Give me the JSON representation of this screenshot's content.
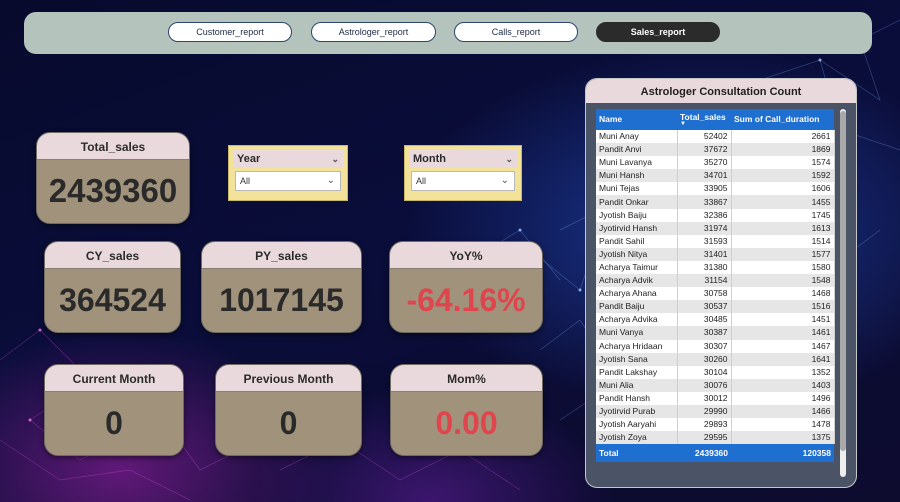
{
  "nav": {
    "tabs": [
      {
        "label": "Customer_report",
        "active": false
      },
      {
        "label": "Astrologer_report",
        "active": false
      },
      {
        "label": "Calls_report",
        "active": false
      },
      {
        "label": "Sales_report",
        "active": true
      }
    ]
  },
  "cards": {
    "total_sales": {
      "title": "Total_sales",
      "value": "2439360"
    },
    "cy_sales": {
      "title": "CY_sales",
      "value": "364524"
    },
    "py_sales": {
      "title": "PY_sales",
      "value": "1017145"
    },
    "yoy": {
      "title": "YoY%",
      "value": "-64.16%"
    },
    "current_month": {
      "title": "Current Month",
      "value": "0"
    },
    "previous_month": {
      "title": "Previous Month",
      "value": "0"
    },
    "mom": {
      "title": "Mom%",
      "value": "0.00"
    }
  },
  "slicers": {
    "year": {
      "label": "Year",
      "value": "All"
    },
    "month": {
      "label": "Month",
      "value": "All"
    }
  },
  "table": {
    "title": "Astrologer Consultation Count",
    "columns": [
      "Name",
      "Total_sales",
      "Sum of Call_duration"
    ],
    "rows": [
      [
        "Muni Anay",
        "52402",
        "2661"
      ],
      [
        "Pandit Anvi",
        "37672",
        "1869"
      ],
      [
        "Muni Lavanya",
        "35270",
        "1574"
      ],
      [
        "Muni Hansh",
        "34701",
        "1592"
      ],
      [
        "Muni Tejas",
        "33905",
        "1606"
      ],
      [
        "Pandit Onkar",
        "33867",
        "1455"
      ],
      [
        "Jyotish Baiju",
        "32386",
        "1745"
      ],
      [
        "Jyotirvid Hansh",
        "31974",
        "1613"
      ],
      [
        "Pandit Sahil",
        "31593",
        "1514"
      ],
      [
        "Jyotish Nitya",
        "31401",
        "1577"
      ],
      [
        "Acharya Taimur",
        "31380",
        "1580"
      ],
      [
        "Acharya Advik",
        "31154",
        "1548"
      ],
      [
        "Acharya Ahana",
        "30758",
        "1468"
      ],
      [
        "Pandit Baiju",
        "30537",
        "1516"
      ],
      [
        "Acharya Advika",
        "30485",
        "1451"
      ],
      [
        "Muni Vanya",
        "30387",
        "1461"
      ],
      [
        "Acharya Hridaan",
        "30307",
        "1467"
      ],
      [
        "Jyotish Sana",
        "30260",
        "1641"
      ],
      [
        "Pandit Lakshay",
        "30104",
        "1352"
      ],
      [
        "Muni Alia",
        "30076",
        "1403"
      ],
      [
        "Pandit Hansh",
        "30012",
        "1496"
      ],
      [
        "Jyotirvid Purab",
        "29990",
        "1466"
      ],
      [
        "Jyotish Aaryahi",
        "29893",
        "1478"
      ],
      [
        "Jyotish Zoya",
        "29595",
        "1375"
      ]
    ],
    "total": {
      "label": "Total",
      "sales": "2439360",
      "duration": "120358"
    }
  },
  "icons": {
    "dropdown": "chevron-down-icon",
    "sort": "sort-desc-icon"
  },
  "colors": {
    "accent": "#1f6fd1",
    "card": "#a1937b",
    "card_header": "#ead9dc",
    "negative": "#e0444d",
    "slicer": "#f3e39a"
  }
}
